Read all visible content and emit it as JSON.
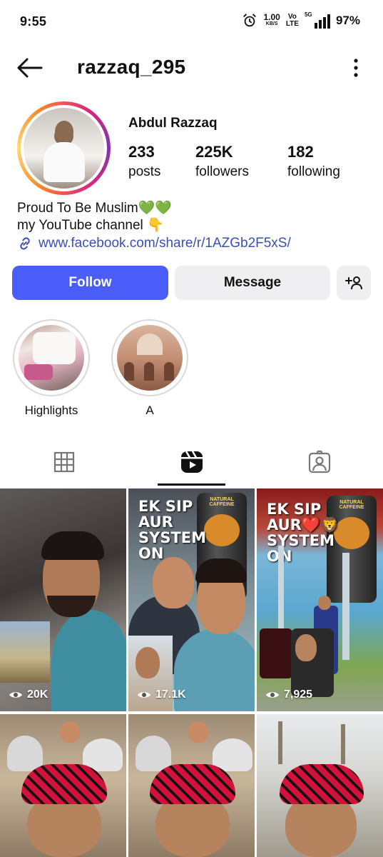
{
  "status_bar": {
    "time": "9:55",
    "net_speed": "1.00",
    "net_unit": "KB/S",
    "volte_top": "Vo",
    "volte_bottom": "LTE",
    "network": "5G",
    "battery": "97%"
  },
  "header": {
    "username": "razzaq_295",
    "back_icon": "arrow-left-icon",
    "more_icon": "vertical-dots-icon"
  },
  "profile": {
    "display_name": "Abdul Razzaq",
    "stats": [
      {
        "value": "233",
        "label": "posts"
      },
      {
        "value": "225K",
        "label": "followers"
      },
      {
        "value": "182",
        "label": "following"
      }
    ],
    "bio_lines": [
      "Proud To Be Muslim💚💚",
      "my YouTube channel 👇"
    ],
    "link": "www.facebook.com/share/r/1AZGb2F5xS/"
  },
  "actions": {
    "follow_label": "Follow",
    "message_label": "Message",
    "add_user_icon": "add-person-icon"
  },
  "highlights": [
    {
      "label": "Highlights"
    },
    {
      "label": "A"
    }
  ],
  "tabs": [
    {
      "name": "grid",
      "icon": "grid-icon"
    },
    {
      "name": "reels",
      "icon": "reels-icon",
      "active": true
    },
    {
      "name": "tagged",
      "icon": "tagged-person-icon"
    }
  ],
  "reels": [
    {
      "views": "20K"
    },
    {
      "views": "17.1K",
      "overlay": [
        "EK SIP",
        "AUR",
        "SYSTEM",
        "ON"
      ]
    },
    {
      "views": "7,925",
      "overlay": [
        "EK SIP",
        "AUR❤️🦁",
        "SYSTEM",
        "ON"
      ]
    },
    {
      "views": ""
    },
    {
      "views": ""
    },
    {
      "views": ""
    }
  ],
  "colors": {
    "follow_button": "#4a5df9",
    "link": "#3a4fb3",
    "secondary_button": "#efeff1"
  }
}
